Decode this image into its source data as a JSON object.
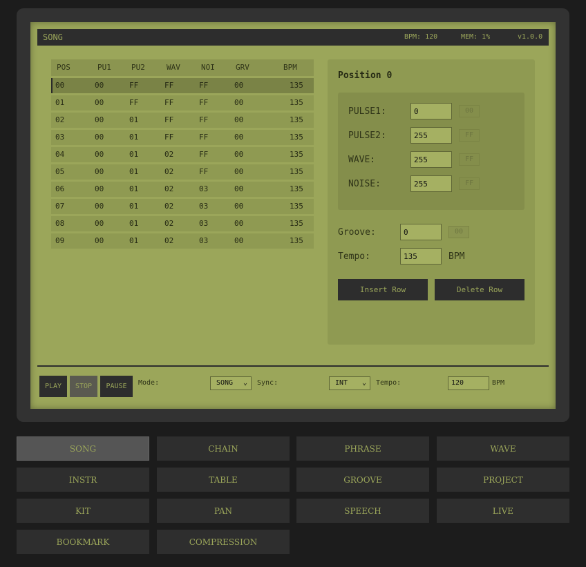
{
  "header": {
    "title": "SONG",
    "bpm": "BPM: 120",
    "mem": "MEM: 1%",
    "version": "v1.0.0"
  },
  "table": {
    "columns": [
      "POS",
      "PU1",
      "PU2",
      "WAV",
      "NOI",
      "GRV",
      "BPM"
    ],
    "rows": [
      [
        "00",
        "00",
        "FF",
        "FF",
        "FF",
        "00",
        "135"
      ],
      [
        "01",
        "00",
        "FF",
        "FF",
        "FF",
        "00",
        "135"
      ],
      [
        "02",
        "00",
        "01",
        "FF",
        "FF",
        "00",
        "135"
      ],
      [
        "03",
        "00",
        "01",
        "FF",
        "FF",
        "00",
        "135"
      ],
      [
        "04",
        "00",
        "01",
        "02",
        "FF",
        "00",
        "135"
      ],
      [
        "05",
        "00",
        "01",
        "02",
        "FF",
        "00",
        "135"
      ],
      [
        "06",
        "00",
        "01",
        "02",
        "03",
        "00",
        "135"
      ],
      [
        "07",
        "00",
        "01",
        "02",
        "03",
        "00",
        "135"
      ],
      [
        "08",
        "00",
        "01",
        "02",
        "03",
        "00",
        "135"
      ],
      [
        "09",
        "00",
        "01",
        "02",
        "03",
        "00",
        "135"
      ]
    ],
    "selected_row": 0
  },
  "panel": {
    "title": "Position 0",
    "channels": [
      {
        "label": "PULSE1:",
        "value": "0",
        "hex": "00"
      },
      {
        "label": "PULSE2:",
        "value": "255",
        "hex": "FF"
      },
      {
        "label": "WAVE:",
        "value": "255",
        "hex": "FF"
      },
      {
        "label": "NOISE:",
        "value": "255",
        "hex": "FF"
      }
    ],
    "groove": {
      "label": "Groove:",
      "value": "0",
      "hex": "00"
    },
    "tempo": {
      "label": "Tempo:",
      "value": "135",
      "unit": "BPM"
    },
    "insert_label": "Insert Row",
    "delete_label": "Delete Row"
  },
  "transport": {
    "play": "PLAY",
    "stop": "STOP",
    "pause": "PAUSE",
    "mode_label": "Mode:",
    "mode_value": "SONG",
    "sync_label": "Sync:",
    "sync_value": "INT",
    "tempo_label": "Tempo:",
    "tempo_value": "120",
    "tempo_unit": "BPM"
  },
  "nav": {
    "items": [
      "SONG",
      "CHAIN",
      "PHRASE",
      "WAVE",
      "INSTR",
      "TABLE",
      "GROOVE",
      "PROJECT",
      "KIT",
      "PAN",
      "SPEECH",
      "LIVE",
      "BOOKMARK",
      "COMPRESSION"
    ],
    "active": "SONG"
  },
  "colors": {
    "screen": "#9ba65a",
    "dark": "#2d2d2d",
    "panel": "#8f9a52",
    "accent_text": "#9ba65a"
  }
}
